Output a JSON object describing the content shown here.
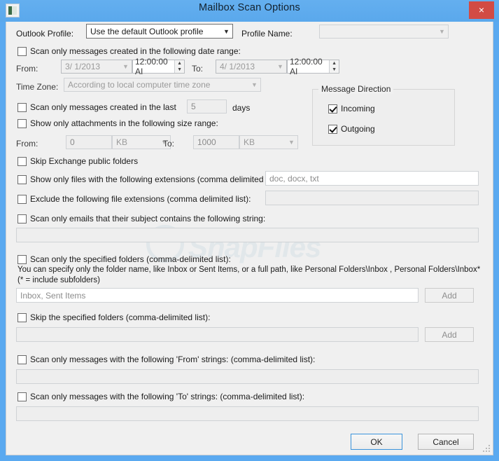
{
  "window": {
    "title": "Mailbox Scan Options",
    "icon": "app-window-icon",
    "close_label": "×",
    "watermark": "SnapFiles",
    "accent_color": "#5aa9f0",
    "close_color": "#d24b44"
  },
  "profile": {
    "outlook_profile_label": "Outlook Profile:",
    "outlook_profile_value": "Use the default Outlook profile",
    "profile_name_label": "Profile Name:",
    "profile_name_value": ""
  },
  "date_range": {
    "checkbox_label": "Scan only messages created in the following date range:",
    "checked": false,
    "from_label": "From:",
    "from_date": "3/  1/2013",
    "from_time": "12:00:00 AI",
    "to_label": "To:",
    "to_date": "4/  1/2013",
    "to_time": "12:00:00 AI",
    "timezone_label": "Time Zone:",
    "timezone_value": "According to local computer time zone"
  },
  "last_days": {
    "checkbox_label": "Scan only messages created in the last",
    "checked": false,
    "value": "5",
    "unit_label": "days"
  },
  "size_range": {
    "checkbox_label": "Show only attachments in the following size range:",
    "checked": false,
    "from_label": "From:",
    "from_value": "0",
    "from_unit": "KB",
    "to_label": "To:",
    "to_value": "1000",
    "to_unit": "KB"
  },
  "message_direction": {
    "group_title": "Message Direction",
    "incoming_label": "Incoming",
    "incoming_checked": true,
    "outgoing_label": "Outgoing",
    "outgoing_checked": true
  },
  "skip_public": {
    "checkbox_label": "Skip Exchange public folders",
    "checked": false
  },
  "include_ext": {
    "checkbox_label": "Show only files with the following extensions (comma delimited list):",
    "checked": false,
    "value": "doc, docx, txt"
  },
  "exclude_ext": {
    "checkbox_label": "Exclude the following file extensions (comma delimited list):",
    "checked": false,
    "value": ""
  },
  "subject": {
    "checkbox_label": "Scan only emails that their subject contains the following string:",
    "checked": false,
    "value": ""
  },
  "include_folders": {
    "checkbox_label": "Scan only the specified folders (comma-delimited list):",
    "checked": false,
    "hint_line1": "You can specify only the folder name, like Inbox or Sent Items, or a full path, like Personal Folders\\Inbox , Personal Folders\\Inbox*",
    "hint_line2": " (* = include subfolders)",
    "value": "Inbox, Sent Items",
    "add_label": "Add"
  },
  "skip_folders": {
    "checkbox_label": "Skip the specified folders (comma-delimited list):",
    "checked": false,
    "value": "",
    "add_label": "Add"
  },
  "from_strings": {
    "checkbox_label": "Scan only messages with the following 'From' strings: (comma-delimited list):",
    "checked": false,
    "value": ""
  },
  "to_strings": {
    "checkbox_label": "Scan only messages with the following 'To' strings: (comma-delimited list):",
    "checked": false,
    "value": ""
  },
  "footer": {
    "ok_label": "OK",
    "cancel_label": "Cancel"
  }
}
